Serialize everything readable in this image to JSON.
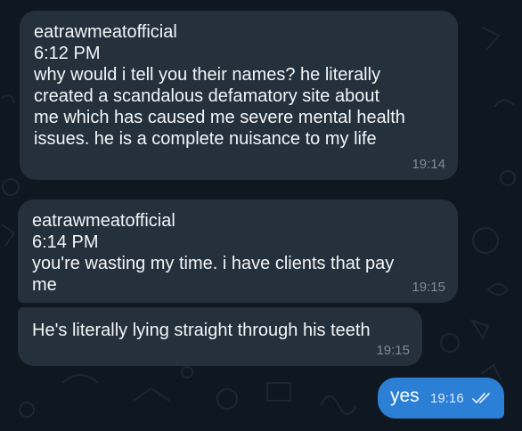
{
  "messages": [
    {
      "sender": "eatrawmeatofficial",
      "sent_time": "6:12 PM",
      "lines": [
        "why would i tell you their names? he literally",
        "created a scandalous defamatory site about",
        "me which has caused me severe mental health",
        "issues. he is a complete nuisance to my life"
      ],
      "time": "19:14"
    },
    {
      "sender": "eatrawmeatofficial",
      "sent_time": "6:14 PM",
      "lines": [
        "you're wasting my time. i have clients that pay",
        "me"
      ],
      "time": "19:15"
    },
    {
      "lines": [
        "He's literally lying straight through his teeth"
      ],
      "time": "19:15"
    }
  ],
  "outgoing": {
    "text": "yes",
    "time": "19:16",
    "status_icon": "double-check-icon"
  },
  "colors": {
    "background": "#0f1720",
    "incoming_bubble": "#24303c",
    "outgoing_bubble": "#2b80d6",
    "timestamp": "#7d8b99"
  }
}
